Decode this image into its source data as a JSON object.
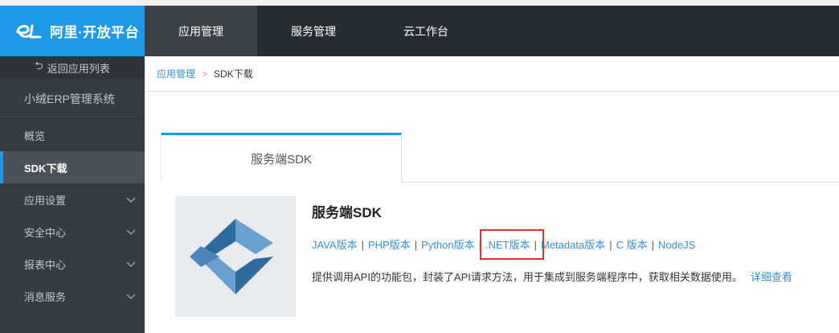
{
  "brand": {
    "title": "阿里·开放平台",
    "logo_icon": "alibaba-e-logo"
  },
  "sidebar": {
    "back_label": "返回应用列表",
    "app_name": "小绒ERP管理系统",
    "items": [
      {
        "label": "概览",
        "has_chevron": false,
        "active": false
      },
      {
        "label": "SDK下载",
        "has_chevron": false,
        "active": true
      },
      {
        "label": "应用设置",
        "has_chevron": true,
        "active": false
      },
      {
        "label": "安全中心",
        "has_chevron": true,
        "active": false
      },
      {
        "label": "报表中心",
        "has_chevron": true,
        "active": false
      },
      {
        "label": "消息服务",
        "has_chevron": true,
        "active": false
      }
    ]
  },
  "topnav": {
    "tabs": [
      {
        "label": "应用管理",
        "active": true
      },
      {
        "label": "服务管理",
        "active": false
      },
      {
        "label": "云工作台",
        "active": false
      }
    ]
  },
  "breadcrumb": {
    "parent": "应用管理",
    "separator": ">",
    "current": "SDK下载"
  },
  "content": {
    "tab_label": "服务端SDK",
    "card": {
      "title": "服务端SDK",
      "links": [
        "JAVA版本",
        "PHP版本",
        "Python版本",
        ".NET版本",
        "Metadata版本",
        "C 版本",
        "NodeJS"
      ],
      "link_separator": "|",
      "highlighted_link": ".NET版本",
      "description": "提供调用API的功能包，封装了API请求方法，用于集成到服务端程序中，获取相关数据使用。",
      "more_label": "详细查看"
    }
  },
  "colors": {
    "accent": "#1e9be8",
    "sidebar_bg": "#363c44",
    "topnav_bg": "#262c33",
    "link": "#3a8fd1",
    "highlight_border": "#d9362c"
  }
}
